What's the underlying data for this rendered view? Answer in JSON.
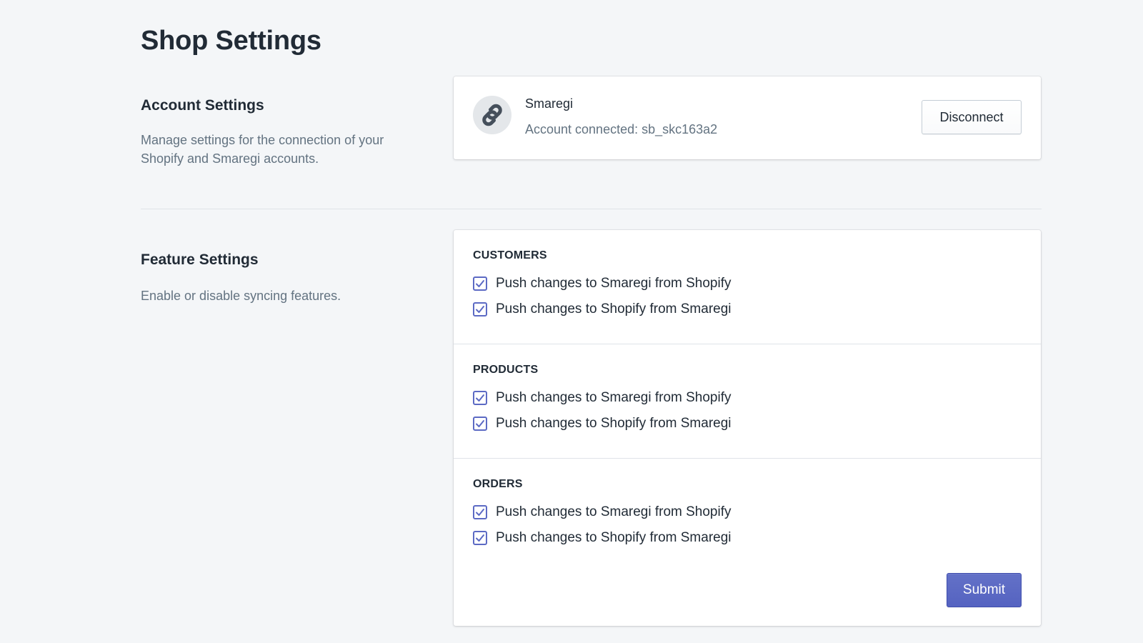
{
  "page": {
    "title": "Shop Settings"
  },
  "account_section": {
    "title": "Account Settings",
    "description": "Manage settings for the connection of your Shopify and Smaregi accounts.",
    "account_name": "Smaregi",
    "account_status": "Account connected: sb_skc163a2",
    "avatar_icon": "link-icon",
    "disconnect_label": "Disconnect"
  },
  "feature_section": {
    "title": "Feature Settings",
    "description": "Enable or disable syncing features.",
    "groups": [
      {
        "heading": "CUSTOMERS",
        "options": [
          {
            "label": "Push changes to Smaregi from Shopify",
            "checked": true
          },
          {
            "label": "Push changes to Shopify from Smaregi",
            "checked": true
          }
        ]
      },
      {
        "heading": "PRODUCTS",
        "options": [
          {
            "label": "Push changes to Smaregi from Shopify",
            "checked": true
          },
          {
            "label": "Push changes to Shopify from Smaregi",
            "checked": true
          }
        ]
      },
      {
        "heading": "ORDERS",
        "options": [
          {
            "label": "Push changes to Smaregi from Shopify",
            "checked": true
          },
          {
            "label": "Push changes to Shopify from Smaregi",
            "checked": true
          }
        ]
      }
    ],
    "submit_label": "Submit"
  },
  "colors": {
    "background": "#f4f6f8",
    "accent": "#5c6ac4",
    "text_primary": "#212b36",
    "text_secondary": "#637381"
  }
}
